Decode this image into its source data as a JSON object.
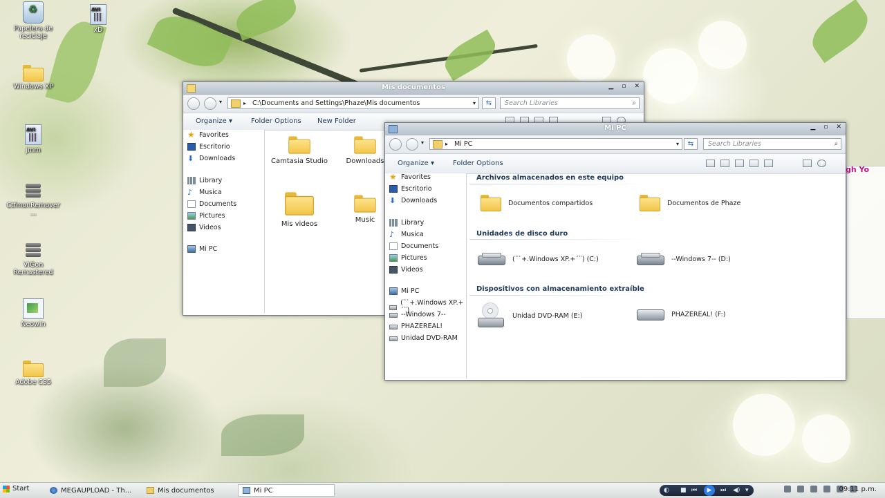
{
  "desktop": {
    "icons": [
      {
        "label": "Papelera de reciclaje",
        "kind": "recycle"
      },
      {
        "label": "xD",
        "kind": "avi"
      },
      {
        "label": "Windows XP",
        "kind": "folder"
      },
      {
        "label": "jmm",
        "kind": "avi"
      },
      {
        "label": "CtfmonRemover ...",
        "kind": "stack"
      },
      {
        "label": "VIGon Remastered",
        "kind": "stack"
      },
      {
        "label": "Neowin",
        "kind": "app"
      },
      {
        "label": "Adobe CS5",
        "kind": "folder"
      }
    ],
    "avi_badge": "AVI",
    "partial_text": "gh Yo"
  },
  "win1": {
    "title": "Mis documentos",
    "address": "C:\\Documents and Settings\\Phaze\\Mis documentos",
    "search_placeholder": "Search Libraries",
    "cmd": {
      "organize": "Organize",
      "folder_options": "Folder Options",
      "new_folder": "New Folder"
    },
    "nav": [
      "Favorites",
      "Escritorio",
      "Downloads",
      "Library",
      "Musica",
      "Documents",
      "Pictures",
      "Videos",
      "Mi PC"
    ],
    "items": [
      "Camtasia Studio",
      "Downloads",
      "Mis videos",
      "Music"
    ]
  },
  "win2": {
    "title": "Mi PC",
    "address": "Mi PC",
    "search_placeholder": "Search Libraries",
    "cmd": {
      "organize": "Organize",
      "folder_options": "Folder Options"
    },
    "nav": [
      "Favorites",
      "Escritorio",
      "Downloads",
      "Library",
      "Musica",
      "Documents",
      "Pictures",
      "Videos",
      "Mi PC",
      "(¨`+.Windows XP.+´¨)",
      "--Windows 7--",
      "PHAZEREAL!",
      "Unidad DVD-RAM"
    ],
    "sections": {
      "stored": {
        "title": "Archivos almacenados en este equipo",
        "items": [
          "Documentos compartidos",
          "Documentos de Phaze"
        ]
      },
      "hdd": {
        "title": "Unidades de disco duro",
        "items": [
          "(¨`+.Windows XP.+´¨) (C:)",
          "--Windows 7-- (D:)"
        ]
      },
      "removable": {
        "title": "Dispositivos con almacenamiento extraíble",
        "items": [
          "Unidad DVD-RAM (E:)",
          "PHAZEREAL! (F:)"
        ]
      }
    }
  },
  "taskbar": {
    "start": "Start",
    "buttons": [
      "MEGAUPLOAD - Th...",
      "Mis documentos",
      "Mi PC"
    ],
    "clock": "09:11 p.m."
  }
}
